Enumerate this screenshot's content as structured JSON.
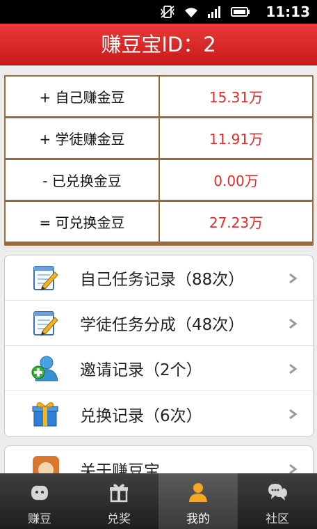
{
  "status_bar": {
    "time": "11:13"
  },
  "header": {
    "title": "赚豆宝ID：2"
  },
  "stats": [
    {
      "label": "+  自己赚金豆",
      "value": "15.31万"
    },
    {
      "label": "+  学徒赚金豆",
      "value": "11.91万"
    },
    {
      "label": "-  已兑换金豆",
      "value": "0.00万"
    },
    {
      "label": "=  可兑换金豆",
      "value": "27.23万"
    }
  ],
  "menu": [
    {
      "label": "自己任务记录（88次）",
      "icon": "notepad-pencil-icon"
    },
    {
      "label": "学徒任务分成（48次）",
      "icon": "notepad-pencil-icon"
    },
    {
      "label": "邀请记录（2个）",
      "icon": "add-user-icon"
    },
    {
      "label": "兑换记录（6次）",
      "icon": "gift-box-icon"
    }
  ],
  "menu2": [
    {
      "label": "关于赚豆宝",
      "icon": "app-logo-icon"
    }
  ],
  "tabs": [
    {
      "label": "赚豆",
      "icon": "bean-icon",
      "active": false
    },
    {
      "label": "兑奖",
      "icon": "gift-icon",
      "active": false
    },
    {
      "label": "我的",
      "icon": "user-icon",
      "active": true
    },
    {
      "label": "社区",
      "icon": "chat-icon",
      "active": false
    }
  ],
  "colors": {
    "header_red": "#d42626",
    "value_red": "#e8282a",
    "table_border": "#9a6a3e",
    "active_tab_icon": "#f5a623"
  }
}
